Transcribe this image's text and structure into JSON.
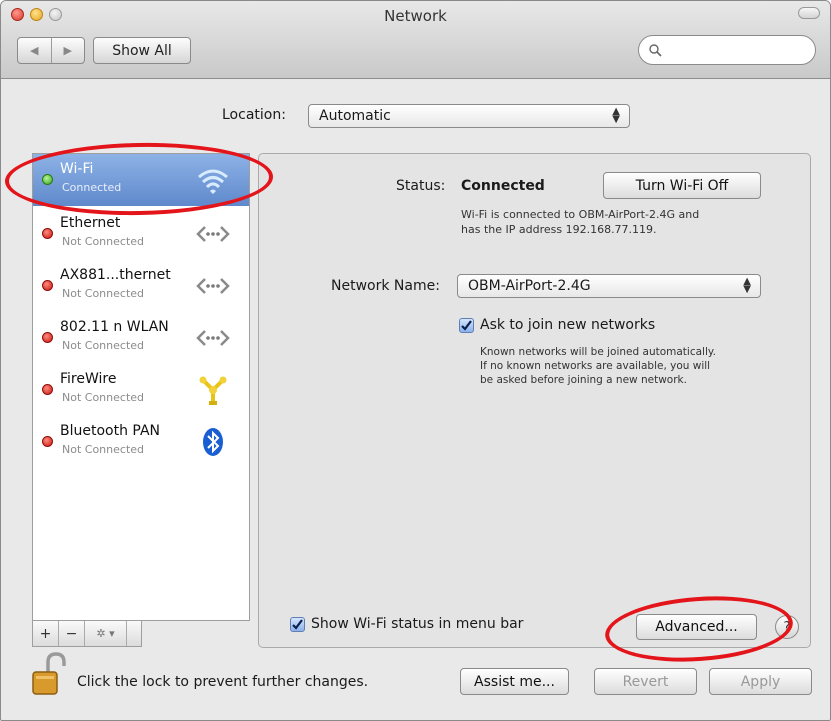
{
  "window": {
    "title": "Network"
  },
  "toolbar": {
    "back_glyph": "◀",
    "forward_glyph": "▶",
    "show_all_label": "Show All",
    "search_placeholder": "",
    "search_value": ""
  },
  "location": {
    "label": "Location:",
    "value": "Automatic"
  },
  "services": [
    {
      "name": "Wi-Fi",
      "status": "Connected",
      "state": "connected",
      "icon": "wifi-icon",
      "selected": true
    },
    {
      "name": "Ethernet",
      "status": "Not Connected",
      "state": "disconnected",
      "icon": "ethernet-icon",
      "selected": false
    },
    {
      "name": "AX881...thernet",
      "status": "Not Connected",
      "state": "disconnected",
      "icon": "ethernet-icon",
      "selected": false
    },
    {
      "name": "802.11 n WLAN",
      "status": "Not Connected",
      "state": "disconnected",
      "icon": "ethernet-icon",
      "selected": false
    },
    {
      "name": "FireWire",
      "status": "Not Connected",
      "state": "disconnected",
      "icon": "firewire-icon",
      "selected": false
    },
    {
      "name": "Bluetooth PAN",
      "status": "Not Connected",
      "state": "disconnected",
      "icon": "bluetooth-icon",
      "selected": false
    }
  ],
  "sidebar_tools": {
    "add": "+",
    "remove": "−",
    "action": "✲ ▾"
  },
  "detail": {
    "status_label": "Status:",
    "status_value": "Connected",
    "turn_off_label": "Turn Wi-Fi Off",
    "status_desc_line1": "Wi-Fi is connected to OBM-AirPort-2.4G and",
    "status_desc_line2": "has the IP address 192.168.77.119.",
    "network_name_label": "Network Name:",
    "network_name_value": "OBM-AirPort-2.4G",
    "ask_join_label": "Ask to join new networks",
    "ask_join_checked": true,
    "ask_desc_line1": "Known networks will be joined automatically.",
    "ask_desc_line2": "If no known networks are available, you will",
    "ask_desc_line3": "be asked before joining a new network.",
    "show_status_label": "Show Wi-Fi status in menu bar",
    "show_status_checked": true,
    "advanced_label": "Advanced...",
    "help_label": "?"
  },
  "footer": {
    "lock_text": "Click the lock to prevent further changes.",
    "assist_label": "Assist me...",
    "revert_label": "Revert",
    "apply_label": "Apply"
  },
  "colors": {
    "selected_row": "#6f95d6",
    "annotation_ring": "#e3141a",
    "status_red": "#c7150d",
    "status_green": "#3aa41a",
    "wifi_blue": "#3b8fe0",
    "firewire_yellow": "#e8c417",
    "bluetooth_blue": "#1a5fd1"
  }
}
